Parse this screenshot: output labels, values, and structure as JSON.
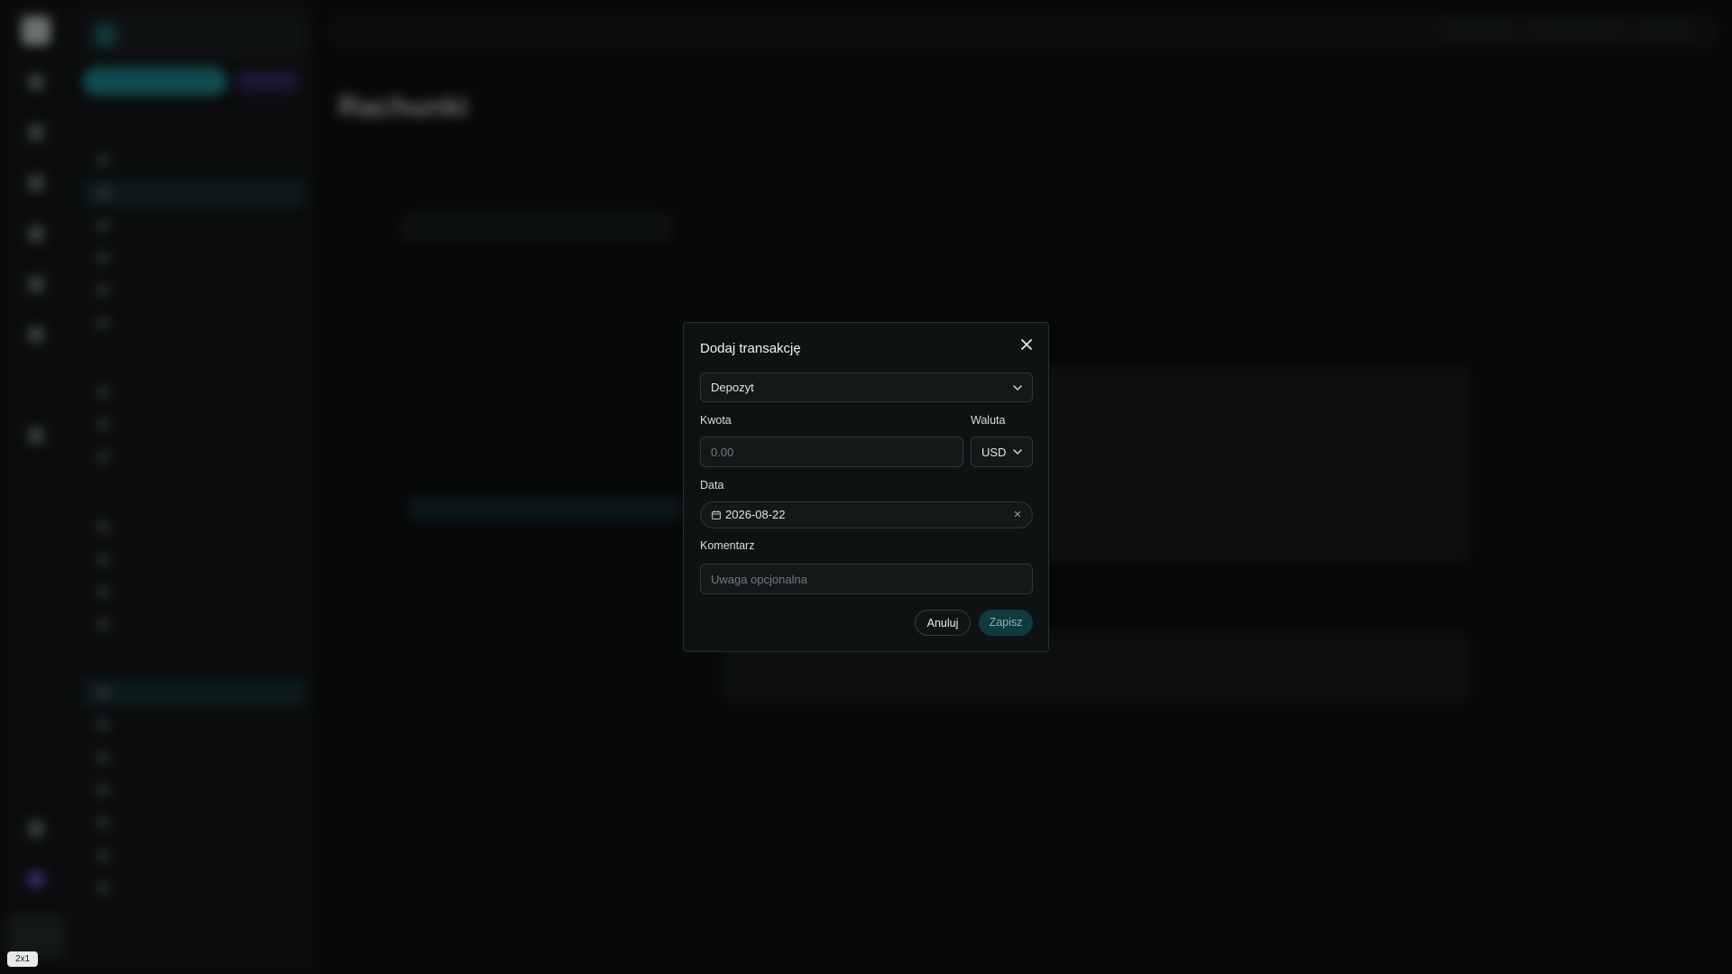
{
  "background": {
    "page_title": "Rachunki"
  },
  "modal": {
    "title": "Dodaj transakcję",
    "type_value": "Depozyt",
    "amount_label": "Kwota",
    "amount_placeholder": "0.00",
    "currency_label": "Waluta",
    "currency_value": "USD",
    "date_label": "Data",
    "date_value": "2026-08-22",
    "comment_label": "Komentarz",
    "comment_placeholder": "Uwaga opcjonalna",
    "cancel_label": "Anuluj",
    "save_label": "Zapisz"
  },
  "zoom_badge": "2x1",
  "colors": {
    "accent": "#1d8f93",
    "save_bg": "#103a3d",
    "positive": "#1f9c49"
  },
  "icons": [
    "close-icon",
    "chevron-down-icon",
    "calendar-icon",
    "clear-icon"
  ]
}
